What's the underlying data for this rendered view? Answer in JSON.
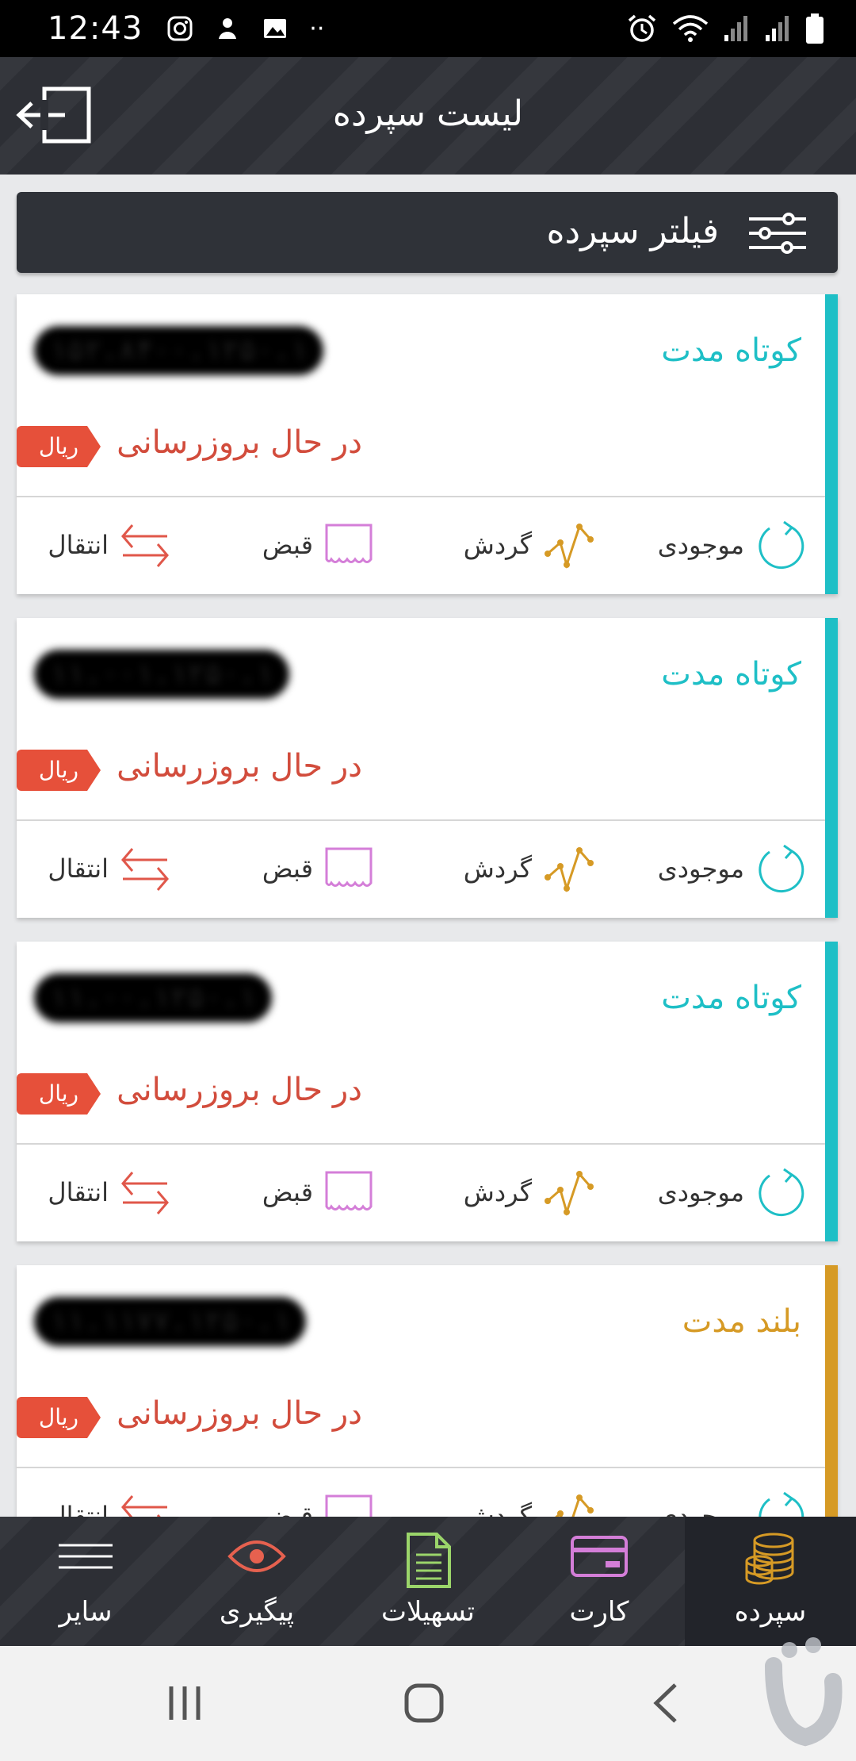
{
  "status_bar": {
    "time": "12:43",
    "icons_left": [
      "instagram-icon",
      "app-icon",
      "gallery-icon",
      "more-dots-icon"
    ],
    "icons_right": [
      "alarm-icon",
      "wifi-icon",
      "signal-icon",
      "signal-icon",
      "battery-icon"
    ]
  },
  "header": {
    "title": "لیست سپرده",
    "exit_icon": "exit-icon"
  },
  "filter": {
    "label": "فیلتر سپرده",
    "icon": "sliders-icon"
  },
  "deposits": [
    {
      "type": "کوتاه مدت",
      "number": "۱۵۲.۸۴۰۰.۱۲۵۰.۱",
      "status": "در حال بروزرسانی",
      "currency": "ریال",
      "color": "#1ebfc6"
    },
    {
      "type": "کوتاه مدت",
      "number": "۱۱.۰۰۱.۱۲۵۰.۱",
      "status": "در حال بروزرسانی",
      "currency": "ریال",
      "color": "#1ebfc6"
    },
    {
      "type": "کوتاه مدت",
      "number": "۱۱.۰۰.۱۲۵۰.۱",
      "status": "در حال بروزرسانی",
      "currency": "ریال",
      "color": "#1ebfc6"
    },
    {
      "type": "بلند مدت",
      "number": "۱۱.۱۱۷۷.۱۲۵۰.۱",
      "status": "در حال بروزرسانی",
      "currency": "ریال",
      "color": "#d69a25"
    }
  ],
  "actions": {
    "balance": "موجودی",
    "turnover": "گردش",
    "bill": "قبض",
    "transfer": "انتقال"
  },
  "bottom_nav": [
    {
      "label": "سپرده",
      "icon": "coins-icon",
      "active": true
    },
    {
      "label": "کارت",
      "icon": "card-icon"
    },
    {
      "label": "تسهیلات",
      "icon": "document-icon"
    },
    {
      "label": "پیگیری",
      "icon": "eye-icon"
    },
    {
      "label": "سایر",
      "icon": "menu-icon"
    }
  ],
  "colors": {
    "header_bg": "#2d2f35",
    "short_term": "#1ebfc6",
    "long_term": "#d69a25",
    "status_red": "#d24c3c",
    "badge_red": "#e6503a",
    "balance_icon": "#1ebfc6",
    "turnover_icon": "#d69a25",
    "bill_icon": "#d47ed8",
    "transfer_icon": "#e0574a"
  }
}
